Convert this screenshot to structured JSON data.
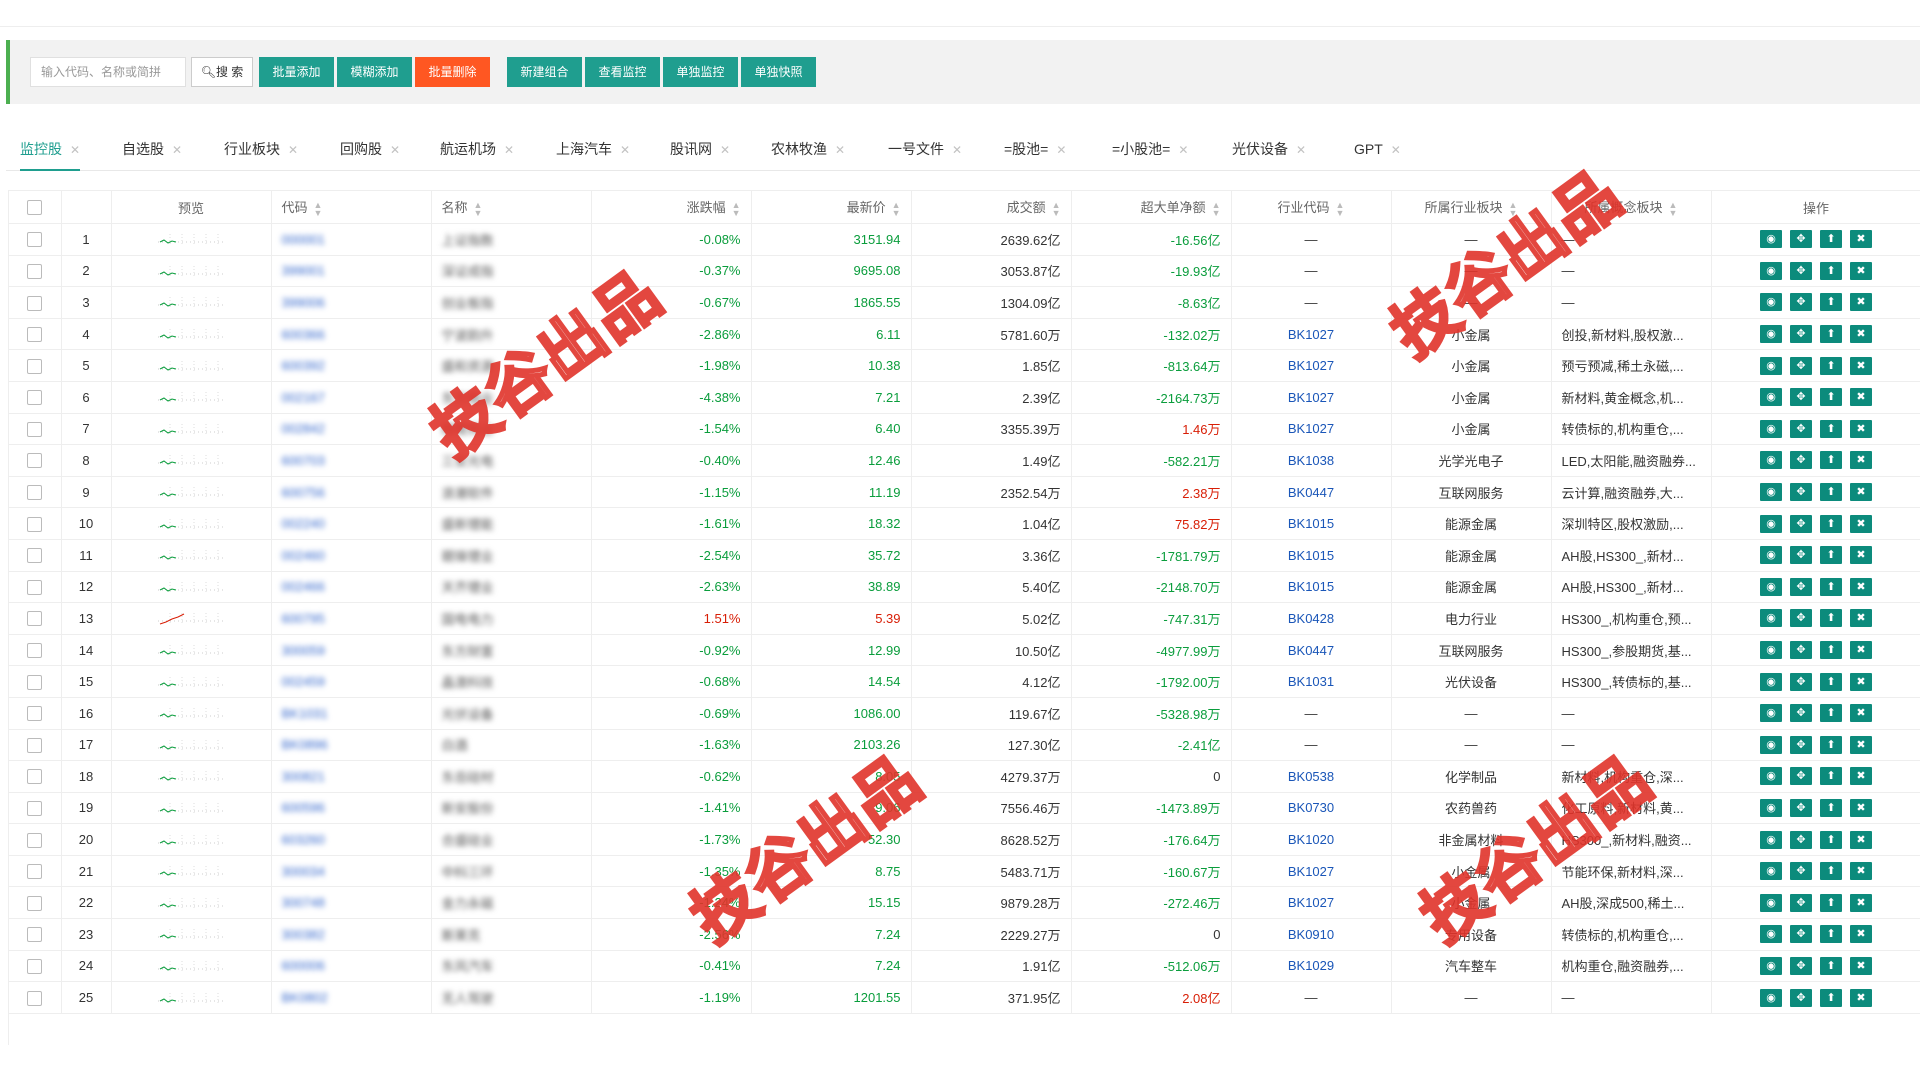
{
  "search": {
    "placeholder": "输入代码、名称或简拼",
    "button": "搜 索"
  },
  "toolbar": {
    "batch_add": "批量添加",
    "fuzzy_add": "模糊添加",
    "batch_delete": "批量删除",
    "new_group": "新建组合",
    "view_monitor": "查看监控",
    "single_monitor": "单独监控",
    "single_snapshot": "单独快照"
  },
  "tabs": [
    "监控股",
    "自选股",
    "行业板块",
    "回购股",
    "航运机场",
    "上海汽车",
    "股讯网",
    "农林牧渔",
    "一号文件",
    "=股池=",
    "=小股池=",
    "光伏设备",
    "GPT"
  ],
  "table": {
    "headers": [
      "预览",
      "代码",
      "名称",
      "涨跌幅",
      "最新价",
      "成交额",
      "超大单净额",
      "行业代码",
      "所属行业板块",
      "所属概念板块",
      "操作"
    ],
    "rows": [
      {
        "no": "1",
        "code": "000001",
        "name": "上证指数",
        "chg": "-0.08%",
        "price": "3151.94",
        "amount": "2639.62亿",
        "net": "-16.56亿",
        "ind_code": "—",
        "ind": "—",
        "concept": "—"
      },
      {
        "no": "2",
        "code": "399001",
        "name": "深证成指",
        "chg": "-0.37%",
        "price": "9695.08",
        "amount": "3053.87亿",
        "net": "-19.93亿",
        "ind_code": "—",
        "ind": "—",
        "concept": "—"
      },
      {
        "no": "3",
        "code": "399006",
        "name": "创业板指",
        "chg": "-0.67%",
        "price": "1865.55",
        "amount": "1304.09亿",
        "net": "-8.63亿",
        "ind_code": "—",
        "ind": "—",
        "concept": "—"
      },
      {
        "no": "4",
        "code": "600366",
        "name": "宁波韵升",
        "chg": "-2.86%",
        "price": "6.11",
        "amount": "5781.60万",
        "net": "-132.02万",
        "ind_code": "BK1027",
        "ind": "小金属",
        "concept": "创投,新材料,股权激..."
      },
      {
        "no": "5",
        "code": "600392",
        "name": "盛和资源",
        "chg": "-1.98%",
        "price": "10.38",
        "amount": "1.85亿",
        "net": "-813.64万",
        "ind_code": "BK1027",
        "ind": "小金属",
        "concept": "预亏预减,稀土永磁,..."
      },
      {
        "no": "6",
        "code": "002167",
        "name": "东方锆业",
        "chg": "-4.38%",
        "price": "7.21",
        "amount": "2.39亿",
        "net": "-2164.73万",
        "ind_code": "BK1027",
        "ind": "小金属",
        "concept": "新材料,黄金概念,机..."
      },
      {
        "no": "7",
        "code": "002842",
        "name": "翔鹭钨业",
        "chg": "-1.54%",
        "price": "6.40",
        "amount": "3355.39万",
        "net": "1.46万",
        "ind_code": "BK1027",
        "ind": "小金属",
        "concept": "转债标的,机构重仓,..."
      },
      {
        "no": "8",
        "code": "600703",
        "name": "三安光电",
        "chg": "-0.40%",
        "price": "12.46",
        "amount": "1.49亿",
        "net": "-582.21万",
        "ind_code": "BK1038",
        "ind": "光学光电子",
        "concept": "LED,太阳能,融资融券..."
      },
      {
        "no": "9",
        "code": "600756",
        "name": "浪潮软件",
        "chg": "-1.15%",
        "price": "11.19",
        "amount": "2352.54万",
        "net": "2.38万",
        "ind_code": "BK0447",
        "ind": "互联网服务",
        "concept": "云计算,融资融券,大..."
      },
      {
        "no": "10",
        "code": "002240",
        "name": "盛新锂能",
        "chg": "-1.61%",
        "price": "18.32",
        "amount": "1.04亿",
        "net": "75.82万",
        "ind_code": "BK1015",
        "ind": "能源金属",
        "concept": "深圳特区,股权激励,..."
      },
      {
        "no": "11",
        "code": "002460",
        "name": "赣锋锂业",
        "chg": "-2.54%",
        "price": "35.72",
        "amount": "3.36亿",
        "net": "-1781.79万",
        "ind_code": "BK1015",
        "ind": "能源金属",
        "concept": "AH股,HS300_,新材..."
      },
      {
        "no": "12",
        "code": "002466",
        "name": "天齐锂业",
        "chg": "-2.63%",
        "price": "38.89",
        "amount": "5.40亿",
        "net": "-2148.70万",
        "ind_code": "BK1015",
        "ind": "能源金属",
        "concept": "AH股,HS300_,新材..."
      },
      {
        "no": "13",
        "code": "600795",
        "name": "国电电力",
        "chg": "1.51%",
        "price": "5.39",
        "amount": "5.02亿",
        "net": "-747.31万",
        "ind_code": "BK0428",
        "ind": "电力行业",
        "concept": "HS300_,机构重仓,预..."
      },
      {
        "no": "14",
        "code": "300059",
        "name": "东方财富",
        "chg": "-0.92%",
        "price": "12.99",
        "amount": "10.50亿",
        "net": "-4977.99万",
        "ind_code": "BK0447",
        "ind": "互联网服务",
        "concept": "HS300_,参股期货,基..."
      },
      {
        "no": "15",
        "code": "002459",
        "name": "晶澳科技",
        "chg": "-0.68%",
        "price": "14.54",
        "amount": "4.12亿",
        "net": "-1792.00万",
        "ind_code": "BK1031",
        "ind": "光伏设备",
        "concept": "HS300_,转债标的,基..."
      },
      {
        "no": "16",
        "code": "BK1031",
        "name": "光伏设备",
        "chg": "-0.69%",
        "price": "1086.00",
        "amount": "119.67亿",
        "net": "-5328.98万",
        "ind_code": "—",
        "ind": "—",
        "concept": "—"
      },
      {
        "no": "17",
        "code": "BK0896",
        "name": "白酒",
        "chg": "-1.63%",
        "price": "2103.26",
        "amount": "127.30亿",
        "net": "-2.41亿",
        "ind_code": "—",
        "ind": "—",
        "concept": "—"
      },
      {
        "no": "18",
        "code": "300821",
        "name": "东岳硅材",
        "chg": "-0.62%",
        "price": "8.05",
        "amount": "4279.37万",
        "net": "0",
        "ind_code": "BK0538",
        "ind": "化学制品",
        "concept": "新材料,机构重仓,深..."
      },
      {
        "no": "19",
        "code": "600596",
        "name": "新安股份",
        "chg": "-1.41%",
        "price": "9.06",
        "amount": "7556.46万",
        "net": "-1473.89万",
        "ind_code": "BK0730",
        "ind": "农药兽药",
        "concept": "化工原料,新材料,黄..."
      },
      {
        "no": "20",
        "code": "603260",
        "name": "合盛硅业",
        "chg": "-1.73%",
        "price": "52.30",
        "amount": "8628.52万",
        "net": "-176.64万",
        "ind_code": "BK1020",
        "ind": "非金属材料",
        "concept": "HS300_,新材料,融资..."
      },
      {
        "no": "21",
        "code": "300034",
        "name": "中科三环",
        "chg": "-1.35%",
        "price": "8.75",
        "amount": "5483.71万",
        "net": "-160.67万",
        "ind_code": "BK1027",
        "ind": "小金属",
        "concept": "节能环保,新材料,深..."
      },
      {
        "no": "22",
        "code": "300748",
        "name": "金力永磁",
        "chg": "-1.24%",
        "price": "15.15",
        "amount": "9879.28万",
        "net": "-272.46万",
        "ind_code": "BK1027",
        "ind": "小金属",
        "concept": "AH股,深成500,稀土..."
      },
      {
        "no": "23",
        "code": "300382",
        "name": "斯莱克",
        "chg": "-2.56%",
        "price": "7.24",
        "amount": "2229.27万",
        "net": "0",
        "ind_code": "BK0910",
        "ind": "专用设备",
        "concept": "转债标的,机构重仓,..."
      },
      {
        "no": "24",
        "code": "600006",
        "name": "东风汽车",
        "chg": "-0.41%",
        "price": "7.24",
        "amount": "1.91亿",
        "net": "-512.06万",
        "ind_code": "BK1029",
        "ind": "汽车整车",
        "concept": "机构重仓,融资融券,..."
      },
      {
        "no": "25",
        "code": "BK0802",
        "name": "无人驾驶",
        "chg": "-1.19%",
        "price": "1201.55",
        "amount": "371.95亿",
        "net": "2.08亿",
        "ind_code": "—",
        "ind": "—",
        "concept": "—"
      }
    ]
  },
  "watermark": "技谷出品",
  "colors": {
    "accent": "#1f9e8f",
    "danger": "#ff5722",
    "up": "#d81e06",
    "down": "#0a9d3c",
    "industry": "#1a56b8",
    "op_button": "#0c8b7c"
  },
  "op_icons": [
    "eye-icon",
    "locate-icon",
    "up-arrow-icon",
    "close-icon"
  ]
}
